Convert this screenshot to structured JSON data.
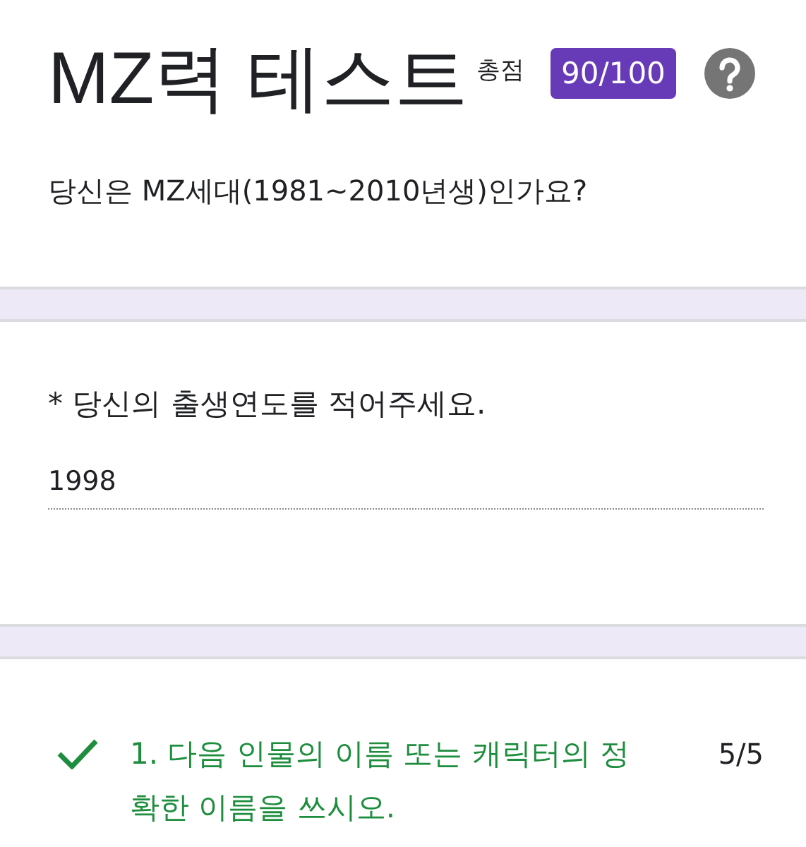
{
  "header": {
    "title": "MZ력 테스트",
    "score_label": "총점",
    "score": "90/100",
    "description": "당신은 MZ세대(1981~2010년생)인가요?"
  },
  "fields": [
    {
      "label": "* 당신의 출생연도를 적어주세요.",
      "value": "1998"
    }
  ],
  "questions": [
    {
      "text": "1. 다음 인물의 이름 또는 캐릭터의 정확한 이름을 쓰시오.",
      "points": "5/5",
      "correct": true
    }
  ]
}
